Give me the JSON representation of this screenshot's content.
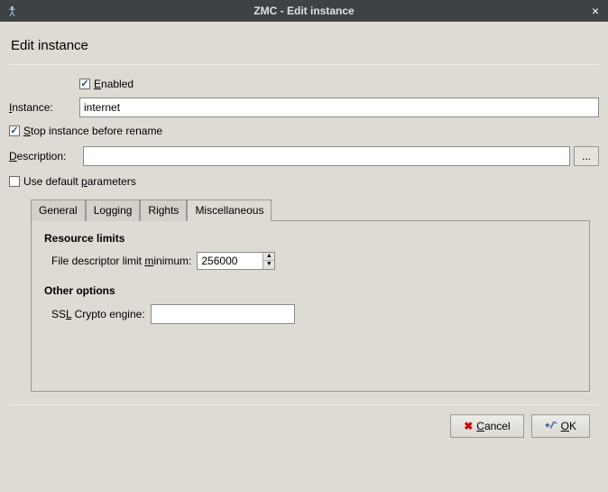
{
  "window": {
    "title": "ZMC - Edit instance"
  },
  "page": {
    "title": "Edit instance"
  },
  "form": {
    "enabled_label": "Enabled",
    "enabled_checked": true,
    "instance_label": "Instance:",
    "instance_value": "internet",
    "stop_before_rename_label": "Stop instance before rename",
    "stop_before_rename_checked": true,
    "description_label": "Description:",
    "description_value": "",
    "description_browse": "...",
    "use_default_params_label": "Use default parameters",
    "use_default_params_checked": false
  },
  "tabs": {
    "general": "General",
    "logging": "Logging",
    "rights": "Rights",
    "misc": "Miscellaneous",
    "active": "misc"
  },
  "misc_panel": {
    "resource_limits_title": "Resource limits",
    "fd_limit_label": "File descriptor limit minimum:",
    "fd_limit_value": "256000",
    "other_options_title": "Other options",
    "ssl_engine_label": "SSL Crypto engine:",
    "ssl_engine_value": ""
  },
  "footer": {
    "cancel": "Cancel",
    "ok": "OK"
  }
}
